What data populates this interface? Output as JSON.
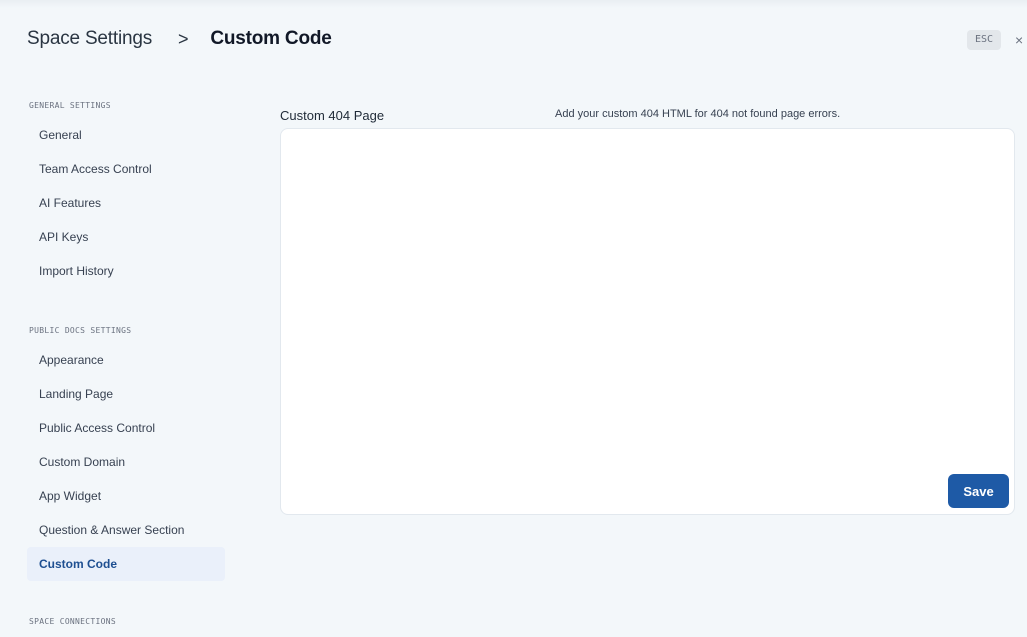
{
  "header": {
    "breadcrumb_parent": "Space Settings",
    "breadcrumb_separator": ">",
    "breadcrumb_current": "Custom Code",
    "esc_label": "ESC",
    "close_glyph": "×"
  },
  "sidebar": {
    "sections": [
      {
        "title": "GENERAL SETTINGS",
        "items": [
          "General",
          "Team Access Control",
          "AI Features",
          "API Keys",
          "Import History"
        ]
      },
      {
        "title": "PUBLIC DOCS SETTINGS",
        "items": [
          "Appearance",
          "Landing Page",
          "Public Access Control",
          "Custom Domain",
          "App Widget",
          "Question & Answer Section",
          "Custom Code"
        ]
      },
      {
        "title": "SPACE CONNECTIONS",
        "items": []
      }
    ],
    "active_item": "Custom Code"
  },
  "main": {
    "field_label": "Custom 404 Page",
    "help_text": "Add your custom 404 HTML for 404 not found page errors.",
    "editor_value": "",
    "save_label": "Save"
  },
  "colors": {
    "background": "#f3f7fa",
    "accent": "#1e5aa6",
    "active_item_bg": "#eaf0fa"
  }
}
